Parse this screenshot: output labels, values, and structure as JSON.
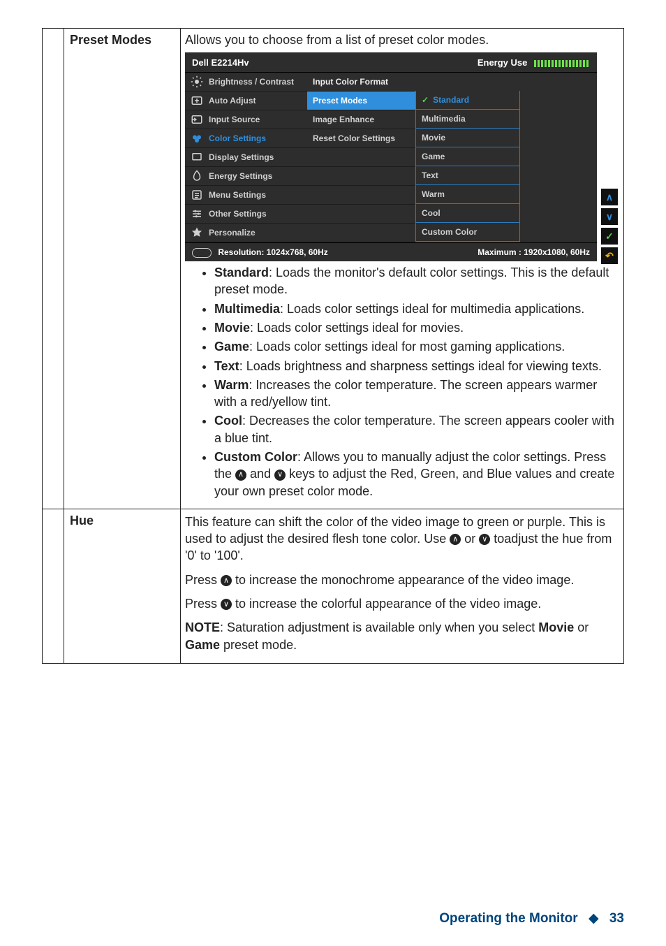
{
  "rows": {
    "preset": {
      "label": "Preset Modes",
      "intro": "Allows you to choose from a list of preset color modes.",
      "bullets": {
        "standard": {
          "name": "Standard",
          "text": ": Loads the monitor's default color settings. This is the default preset mode."
        },
        "multimedia": {
          "name": "Multimedia",
          "text": ": Loads color settings ideal for multimedia applications."
        },
        "movie": {
          "name": "Movie",
          "text": ": Loads color settings ideal for movies."
        },
        "game": {
          "name": "Game",
          "text": ": Loads color settings ideal for most gaming applications."
        },
        "textmode": {
          "name": "Text",
          "text": ": Loads brightness and sharpness settings ideal for viewing texts."
        },
        "warm": {
          "name": "Warm",
          "text": ": Increases the color temperature. The screen appears warmer with a red/yellow tint."
        },
        "cool": {
          "name": "Cool",
          "text": ": Decreases the color temperature. The screen appears cooler with a blue tint."
        },
        "custom": {
          "name": "Custom Color",
          "text1": ": Allows you to manually adjust the color settings. Press the ",
          "mid": " and ",
          "text2": " keys to adjust the Red, Green, and Blue values and create your own preset color mode."
        }
      }
    },
    "hue": {
      "label": "Hue",
      "p1a": "This feature can shift the color of the video image to green or purple. This is used to adjust the desired flesh tone color. Use ",
      "p1b": " or ",
      "p1c": " toadjust the hue from '0' to '100'.",
      "p2a": "Press ",
      "p2b": " to increase the monochrome appearance of the video image.",
      "p3a": "Press ",
      "p3b": " to increase the colorful appearance of the video image.",
      "p4a": "NOTE",
      "p4b": ": Saturation adjustment is available only when you select ",
      "p4c": "Movie",
      "p4d": " or ",
      "p4e": "Game",
      "p4f": " preset mode."
    }
  },
  "osd": {
    "model": "Dell E2214Hv",
    "energy": "Energy Use",
    "menu": [
      "Brightness / Contrast",
      "Auto Adjust",
      "Input Source",
      "Color Settings",
      "Display Settings",
      "Energy Settings",
      "Menu Settings",
      "Other Settings",
      "Personalize"
    ],
    "sub_header": "Input Color Format",
    "sub": [
      "Preset Modes",
      "Image Enhance",
      "Reset Color Settings"
    ],
    "options": [
      "Standard",
      "Multimedia",
      "Movie",
      "Game",
      "Text",
      "Warm",
      "Cool",
      "Custom Color"
    ],
    "resolution": "Resolution: 1024x768,   60Hz",
    "maximum": "Maximum : 1920x1080,   60Hz"
  },
  "footer": {
    "title": "Operating the Monitor",
    "page": "33"
  }
}
